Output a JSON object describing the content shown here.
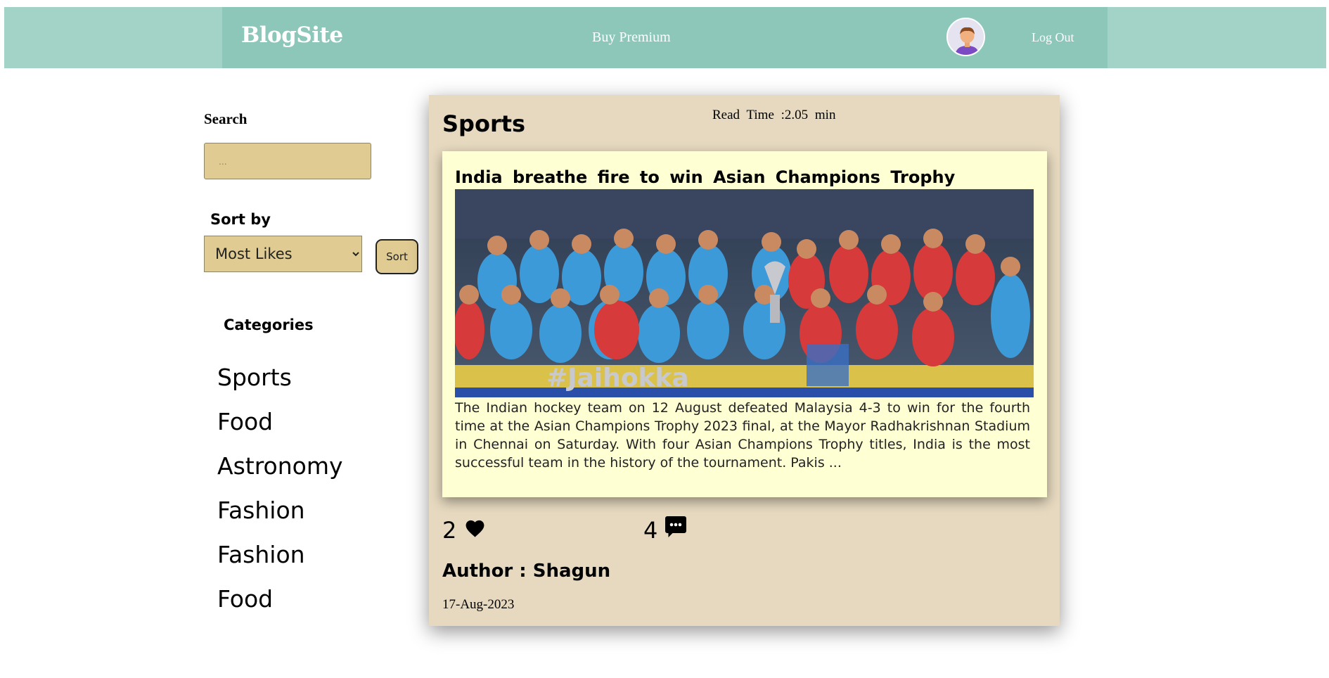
{
  "header": {
    "logo": "BlogSite",
    "premium_label": "Buy Premium",
    "logout_label": "Log Out",
    "avatar_icon": "user-avatar-icon"
  },
  "sidebar": {
    "search_label": "Search",
    "search_placeholder": "...",
    "search_value": "",
    "sort_label": "Sort by",
    "sort_selected": "Most Likes",
    "sort_button_label": "Sort",
    "categories_heading": "Categories",
    "categories": [
      "Sports",
      "Food",
      "Astronomy",
      "Fashion",
      "Fashion",
      "Food"
    ]
  },
  "post": {
    "category": "Sports",
    "read_time": "Read Time :2.05 min",
    "title": "India breathe fire to win Asian Champions Trophy",
    "excerpt": "The Indian hockey team on 12 August defeated Malaysia 4-3 to win for the fourth time at the Asian Champions Trophy 2023 final, at the Mayor Radhakrishnan Stadium in Chennai on Saturday. With four Asian Champions Trophy titles, India is the most successful team in the history of the tournament. Pakis ...",
    "likes": "2",
    "comments": "4",
    "author": "Author : Shagun",
    "date": "17-Aug-2023",
    "image_caption": "#Jaihokka"
  },
  "colors": {
    "header_band": "#a3d3c6",
    "header_inner": "#8cc7b9",
    "input_bg": "#e0cc93",
    "card_bg": "#e6d9bf",
    "post_bg": "#ffffd4"
  },
  "icons": {
    "like": "heart-icon",
    "comment": "comment-bubble-icon"
  }
}
